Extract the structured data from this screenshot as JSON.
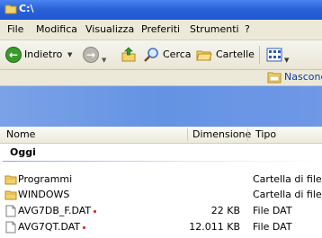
{
  "window": {
    "title": "C:\\"
  },
  "menu": [
    "File",
    "Modifica",
    "Visualizza",
    "Preferiti",
    "Strumenti",
    "?"
  ],
  "toolbar": {
    "back_label": "Indietro",
    "search_label": "Cerca",
    "folders_label": "Cartelle"
  },
  "address": {
    "item_label": "Nascond"
  },
  "columns": {
    "name": "Nome",
    "size": "Dimensione",
    "type": "Tipo"
  },
  "group": {
    "label": "Oggi"
  },
  "files": [
    {
      "name": "Programmi",
      "size": "",
      "type": "Cartella di file",
      "icon": "folder-icon"
    },
    {
      "name": "WINDOWS",
      "size": "",
      "type": "Cartella di file",
      "icon": "folder-icon"
    },
    {
      "name": "AVG7DB_F.DAT",
      "size": "22 KB",
      "type": "File DAT",
      "icon": "file-icon"
    },
    {
      "name": "AVG7QT.DAT",
      "size": "12.011 KB",
      "type": "File DAT",
      "icon": "file-icon"
    }
  ],
  "colors": {
    "title_bar": "#2c62d8",
    "menu_bg": "#ece9d8",
    "task_pane": "#6f98e6",
    "back_green": "#3a9b2b"
  }
}
